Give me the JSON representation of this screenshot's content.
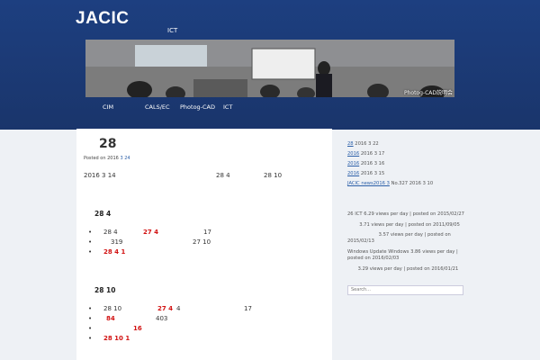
{
  "header": {
    "site_title": "JACIC",
    "tagline": "ICT",
    "banner_caption": "Photog-CAD説明会"
  },
  "nav": {
    "items": [
      "CIM",
      "CALS/EC",
      "Photog-CAD",
      "ICT"
    ]
  },
  "post": {
    "title": "28",
    "posted_prefix": "Posted on 2016",
    "posted_date": "3  24",
    "intro": {
      "date": "2016  3  14",
      "mid": "28  4",
      "end": "28  10"
    },
    "section1": {
      "heading": "28  4",
      "items": [
        {
          "text": "28  4",
          "red": "27  4",
          "right": "17"
        },
        {
          "text": "319",
          "red": "",
          "right": "27  10"
        },
        {
          "text": "",
          "red": "28  4  1",
          "right": ""
        }
      ]
    },
    "section2": {
      "heading": "28  10",
      "items": [
        {
          "text": "28  10",
          "red": "27  4",
          "mid": "4",
          "right": "17"
        },
        {
          "text": "403",
          "red": "84",
          "right": ""
        },
        {
          "text": "",
          "red": "16",
          "right": ""
        },
        {
          "text": "",
          "red": "28  10  1",
          "right": ""
        }
      ]
    }
  },
  "sidebar": {
    "recent": [
      {
        "link": "28",
        "meta": "2016  3  22"
      },
      {
        "link": "2016",
        "meta": "2016  3  17"
      },
      {
        "link": "2016",
        "meta": "2016  3  16"
      },
      {
        "link": "2016",
        "meta": "2016  3  15"
      },
      {
        "link": "JACIC news2016  3",
        "meta": "No.327  2016  3  10"
      }
    ],
    "popular": [
      {
        "link": "26     ICT",
        "meta": "6.29 views per day | posted on 2015/02/27"
      },
      {
        "link": "",
        "meta": "3.71 views per day | posted on 2011/09/05"
      },
      {
        "link": "",
        "meta": "3.57 views per day | posted on 2015/02/13"
      },
      {
        "link": "Windows Update    Windows",
        "meta": "3.86 views per day | posted on 2016/02/03"
      },
      {
        "link": "",
        "meta": "3.29 views per day | posted on 2016/01/21"
      }
    ],
    "search_placeholder": "Search..."
  }
}
